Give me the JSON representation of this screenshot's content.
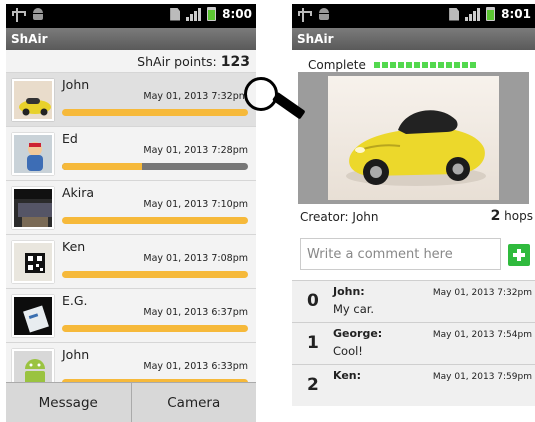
{
  "left_phone": {
    "status": {
      "time": "8:00"
    },
    "app_title": "ShAir",
    "points_label": "ShAir points:",
    "points_value": "123",
    "items": [
      {
        "name": "John",
        "time": "May 01, 2013  7:32pm",
        "progress": 1.0
      },
      {
        "name": "Ed",
        "time": "May 01, 2013  7:28pm",
        "progress": 0.43
      },
      {
        "name": "Akira",
        "time": "May 01, 2013  7:10pm",
        "progress": 1.0
      },
      {
        "name": "Ken",
        "time": "May 01, 2013  7:08pm",
        "progress": 1.0
      },
      {
        "name": "E.G.",
        "time": "May 01, 2013  6:37pm",
        "progress": 1.0
      },
      {
        "name": "John",
        "time": "May 01, 2013  6:33pm",
        "progress": 1.0
      }
    ],
    "buttons": {
      "message": "Message",
      "camera": "Camera"
    }
  },
  "right_phone": {
    "status": {
      "time": "8:01"
    },
    "app_title": "ShAir",
    "complete_label": "Complete",
    "creator": "Creator: John",
    "hops_value": "2",
    "hops_label": "hops",
    "comment_placeholder": "Write a comment here",
    "comments": [
      {
        "num": "0",
        "author": "John:",
        "text": "My car.",
        "time": "May 01, 2013  7:32pm"
      },
      {
        "num": "1",
        "author": "George:",
        "text": "Cool!",
        "time": "May 01, 2013  7:54pm"
      },
      {
        "num": "2",
        "author": "Ken:",
        "text": "",
        "time": "May 01, 2013  7:59pm"
      }
    ]
  },
  "colors": {
    "progress": "#f6b93a",
    "complete_dots": "#53d84e",
    "add_button": "#2fba3d"
  },
  "icons": [
    "usb-icon",
    "android-icon",
    "sim-icon",
    "signal-icon",
    "battery-icon",
    "magnifier-icon",
    "add-icon"
  ]
}
